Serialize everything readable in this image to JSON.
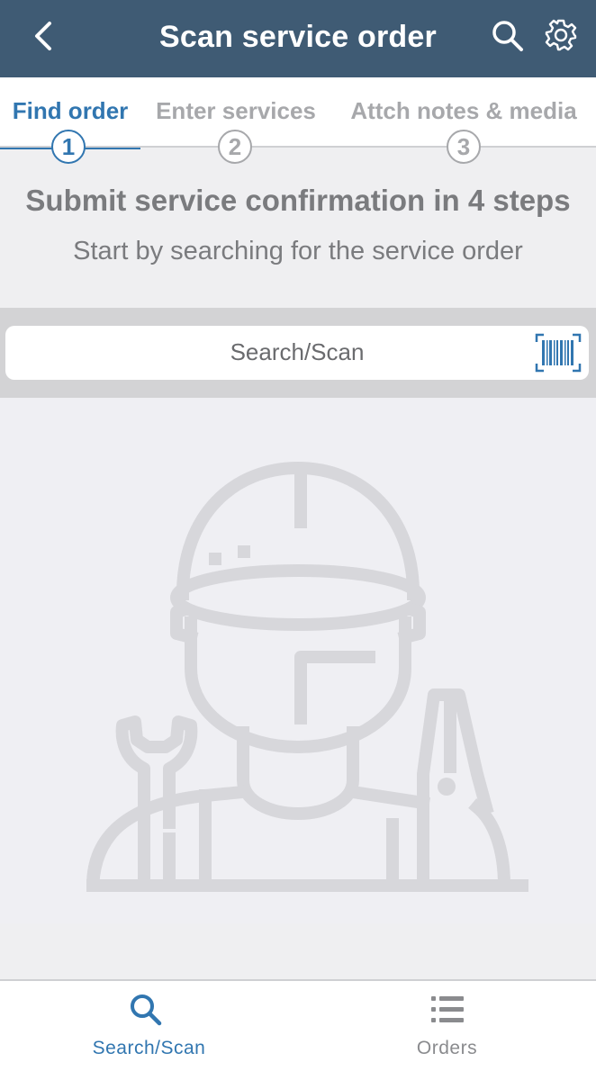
{
  "header": {
    "title": "Scan service order",
    "back_icon": "chevron-left-icon",
    "search_icon": "search-icon",
    "settings_icon": "gear-icon"
  },
  "steps": [
    {
      "label": "Find order",
      "number": "1",
      "active": true
    },
    {
      "label": "Enter services",
      "number": "2",
      "active": false
    },
    {
      "label": "Attch notes & media",
      "number": "3",
      "active": false
    }
  ],
  "intro": {
    "heading": "Submit service confirmation in 4 steps",
    "subheading": "Start by searching for the service order"
  },
  "search": {
    "placeholder": "Search/Scan",
    "barcode_icon": "barcode-scan-icon"
  },
  "illustration": {
    "icon": "technician-illustration"
  },
  "bottom_nav": [
    {
      "label": "Search/Scan",
      "icon": "search-icon",
      "active": true
    },
    {
      "label": "Orders",
      "icon": "list-icon",
      "active": false
    }
  ],
  "colors": {
    "header_bg": "#3f5b74",
    "accent": "#3176b0",
    "inactive": "#a7a8ab",
    "text_muted": "#7a7b7e",
    "illustration": "#d7d7db"
  }
}
